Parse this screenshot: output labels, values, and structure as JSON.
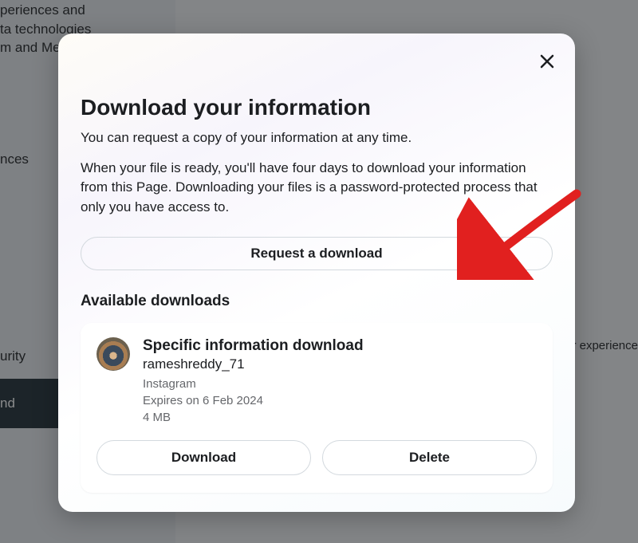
{
  "background": {
    "sidebar_fragments": {
      "line1": "periences and",
      "line2": "ta technologies",
      "line3": "m and Meta",
      "line4": "nces",
      "line5": "urity"
    },
    "active_item_fragment": "nd",
    "right_fragment": "ur experience"
  },
  "modal": {
    "title": "Download your information",
    "subtitle": "You can request a copy of your information at any time.",
    "description": "When your file is ready, you'll have four days to download your information from this Page. Downloading your files is a password-protected process that only you have access to.",
    "request_button": "Request a download",
    "section_title": "Available downloads"
  },
  "download_item": {
    "title": "Specific information download",
    "username": "rameshreddy_71",
    "platform": "Instagram",
    "expires": "Expires on 6 Feb 2024",
    "size": "4 MB",
    "download_label": "Download",
    "delete_label": "Delete"
  }
}
